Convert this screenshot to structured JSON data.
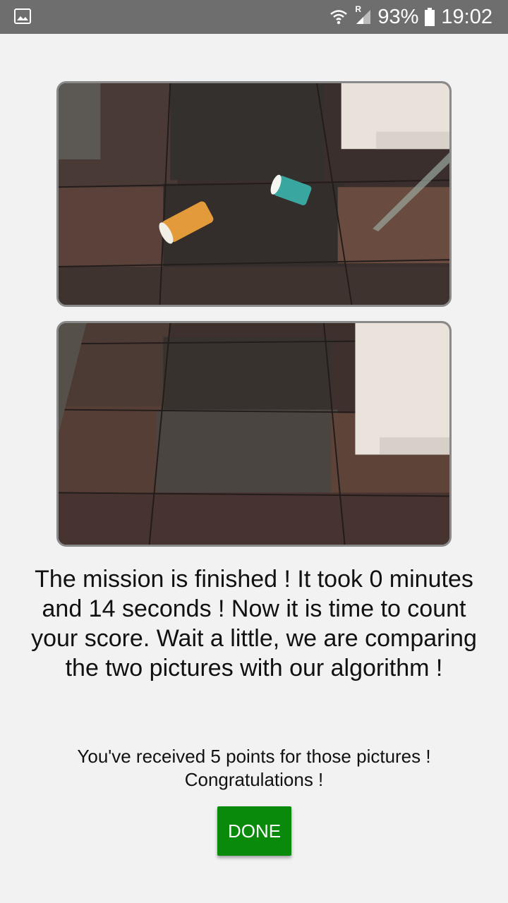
{
  "status_bar": {
    "battery": "93%",
    "time": "19:02",
    "roaming_label": "R",
    "icons": [
      "gallery-icon",
      "wifi-icon",
      "signal-icon",
      "battery-icon"
    ],
    "background_color": "#6e6e6e"
  },
  "photos": {
    "before": {
      "description_icon": "floor-with-trash-photo"
    },
    "after": {
      "description_icon": "clean-floor-photo"
    }
  },
  "mission": {
    "message": "The mission is finished ! It took 0 minutes and 14 seconds ! Now it is time to count your score. Wait a little, we are comparing the two pictures with our algorithm !"
  },
  "score": {
    "message": "You've received 5 points for those pictures ! Congratulations !"
  },
  "actions": {
    "done_label": "DONE",
    "done_color": "#0a8a0a"
  }
}
